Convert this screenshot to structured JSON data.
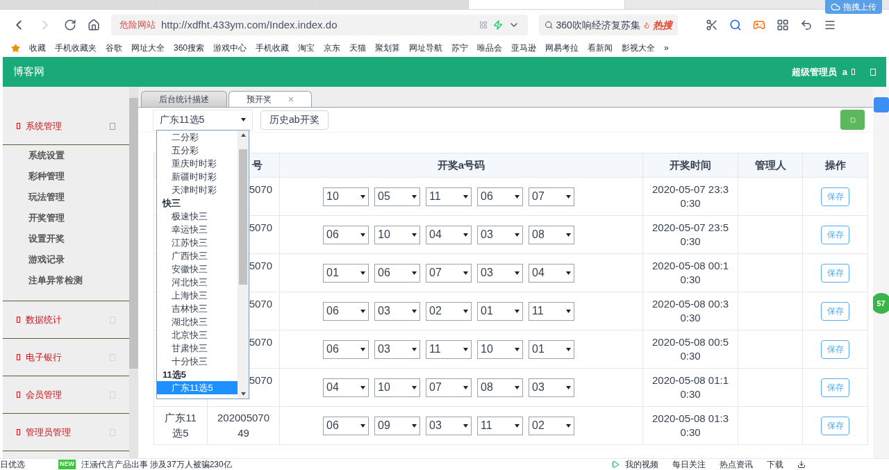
{
  "browser": {
    "tabs": [
      {
        "selected": false
      },
      {
        "selected": false
      },
      {
        "selected": false
      },
      {
        "selected": true
      }
    ],
    "address": {
      "warning": "危险网站",
      "url": "http://xdfht.433ym.com/Index.index.do"
    },
    "search": {
      "value": "360吹响经济复苏集",
      "hot": "热搜"
    },
    "upload": "拖拽上传",
    "bookmarks": [
      "收藏",
      "手机收藏夹",
      "谷歌",
      "网址大全",
      "360搜索",
      "游戏中心",
      "手机收藏",
      "淘宝",
      "京东",
      "天猫",
      "聚划算",
      "网址导航",
      "苏宁",
      "唯品会",
      "亚马逊",
      "网易考拉",
      "看新闻",
      "影视大全"
    ],
    "more": "»"
  },
  "header": {
    "title": "博客网",
    "user_role": "超级管理员",
    "user": "a"
  },
  "sidebar": [
    {
      "label": "系统管理",
      "expanded": true,
      "children": [
        {
          "label": "系统设置"
        },
        {
          "label": "彩种管理"
        },
        {
          "label": "玩法管理"
        },
        {
          "label": "开奖管理"
        },
        {
          "label": "设置开奖"
        },
        {
          "label": "游戏记录"
        },
        {
          "label": "注单异常检测"
        }
      ]
    },
    {
      "label": "数据统计",
      "expanded": false
    },
    {
      "label": "电子银行",
      "expanded": false
    },
    {
      "label": "会员管理",
      "expanded": false
    },
    {
      "label": "管理员管理",
      "expanded": false
    }
  ],
  "tabs": [
    {
      "label": "后台统计描述",
      "selected": false,
      "closable": false
    },
    {
      "label": "预开奖",
      "selected": true,
      "closable": true
    }
  ],
  "toolbar": {
    "lottery_select": "广东11选5",
    "history_button": "历史ab开奖"
  },
  "dropdown": [
    {
      "kind": "option",
      "label": "二分彩",
      "selected": false
    },
    {
      "kind": "option",
      "label": "五分彩",
      "selected": false
    },
    {
      "kind": "option",
      "label": "重庆时时彩",
      "selected": false
    },
    {
      "kind": "option",
      "label": "新疆时时彩",
      "selected": false
    },
    {
      "kind": "option",
      "label": "天津时时彩",
      "selected": false
    },
    {
      "kind": "group",
      "label": "快三",
      "children": [
        {
          "label": "极速快三",
          "selected": false
        },
        {
          "label": "幸运快三",
          "selected": false
        },
        {
          "label": "江苏快三",
          "selected": false
        },
        {
          "label": "广西快三",
          "selected": false
        },
        {
          "label": "安徽快三",
          "selected": false
        },
        {
          "label": "河北快三",
          "selected": false
        },
        {
          "label": "上海快三",
          "selected": false
        },
        {
          "label": "吉林快三",
          "selected": false
        },
        {
          "label": "湖北快三",
          "selected": false
        },
        {
          "label": "北京快三",
          "selected": false
        },
        {
          "label": "甘肃快三",
          "selected": false
        },
        {
          "label": "十分快三",
          "selected": false
        }
      ]
    },
    {
      "kind": "group",
      "label": "11选5",
      "children": [
        {
          "label": "广东11选5",
          "selected": true
        }
      ]
    }
  ],
  "table": {
    "columns": [
      "",
      "号",
      "开奖a号码",
      "开奖时间",
      "管理人",
      "操作"
    ],
    "rows": [
      {
        "lottery": "",
        "issue": "5070",
        "numbers": [
          "10",
          "05",
          "11",
          "06",
          "07"
        ],
        "time": "2020-05-07 23:30:30",
        "action": "保存"
      },
      {
        "lottery": "",
        "issue": "5070",
        "numbers": [
          "06",
          "10",
          "04",
          "03",
          "08"
        ],
        "time": "2020-05-07 23:50:30",
        "action": "保存"
      },
      {
        "lottery": "",
        "issue": "5070",
        "numbers": [
          "01",
          "06",
          "07",
          "03",
          "04"
        ],
        "time": "2020-05-08 00:10:30",
        "action": "保存"
      },
      {
        "lottery": "",
        "issue": "5070",
        "numbers": [
          "06",
          "03",
          "02",
          "01",
          "11"
        ],
        "time": "2020-05-08 00:30:30",
        "action": "保存"
      },
      {
        "lottery": "",
        "issue": "5070",
        "numbers": [
          "06",
          "03",
          "11",
          "10",
          "01"
        ],
        "time": "2020-05-08 00:50:30",
        "action": "保存"
      },
      {
        "lottery": "",
        "issue": "5070",
        "numbers": [
          "04",
          "10",
          "07",
          "08",
          "03"
        ],
        "time": "2020-05-08 01:10:30",
        "action": "保存"
      },
      {
        "lottery": "广东11选5",
        "issue": "20200507049",
        "numbers": [
          "06",
          "09",
          "03",
          "11",
          "02"
        ],
        "time": "2020-05-08 01:30:30",
        "action": "保存"
      }
    ]
  },
  "float_badge": "57",
  "status_bar": {
    "left": "日优选",
    "news_badge": "NEW",
    "news": "汪涵代言产品出事 涉及37万人被骗230亿",
    "links": [
      "我的视频",
      "每日关注",
      "热点资讯",
      "下载"
    ]
  }
}
